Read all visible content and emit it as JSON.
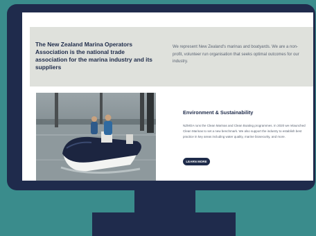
{
  "hero": {
    "title": "The New Zealand Marina Operators Association is the national trade association for the marina industry and its suppliers",
    "description": "We represent New Zealand's marinas and boatyards. We are a non-profit, volunteer run organisation that seeks optimal outcomes for our industry."
  },
  "feature": {
    "photo": "boat-photo",
    "title": "Environment & Sustainability",
    "text": "NZMOA runs the Clean Marinas and Clean Boating programmes. In 2020 we relaunched Clean Marinas to set a new benchmark. We also support the industry to establish best practice in key areas including water quality, marine biosecurity, and more.",
    "button_label": "LEARN MORE"
  },
  "colors": {
    "background": "#3a8c8c",
    "monitor": "#1f2b4c",
    "hero_band": "#dfe1dc",
    "heading": "#1e2b4a",
    "button": "#1e2b4a"
  }
}
